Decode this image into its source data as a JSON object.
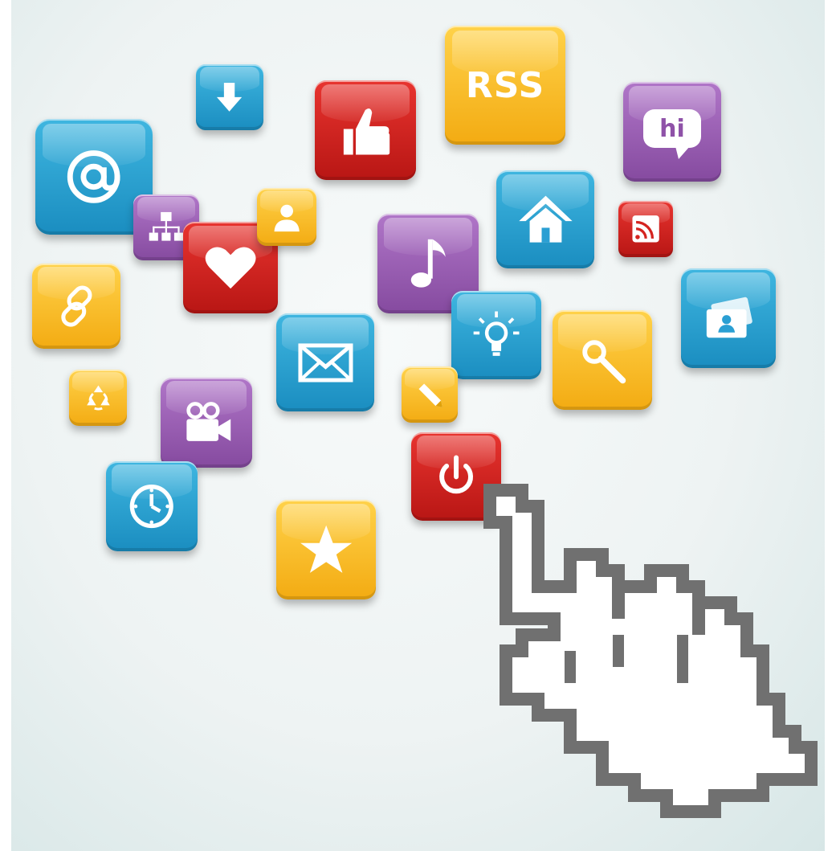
{
  "tiles": {
    "rss_label": "RSS",
    "chat_label": "hi"
  },
  "colors": {
    "blue": "#2a9fd3",
    "red": "#d42420",
    "yellow": "#f8bd2a",
    "purple": "#9a5cb4",
    "background": "#eef3f3"
  },
  "icons": [
    "download-icon",
    "thumbs-up-icon",
    "rss-text-icon",
    "chat-bubble-icon",
    "at-sign-icon",
    "sitemap-icon",
    "user-icon",
    "heart-icon",
    "music-note-icon",
    "home-icon",
    "wifi-feed-icon",
    "link-icon",
    "lightbulb-icon",
    "search-icon",
    "contact-card-icon",
    "mail-icon",
    "recycle-icon",
    "video-camera-icon",
    "pencil-icon",
    "power-icon",
    "clock-icon",
    "star-icon",
    "pixel-hand-cursor-icon"
  ]
}
